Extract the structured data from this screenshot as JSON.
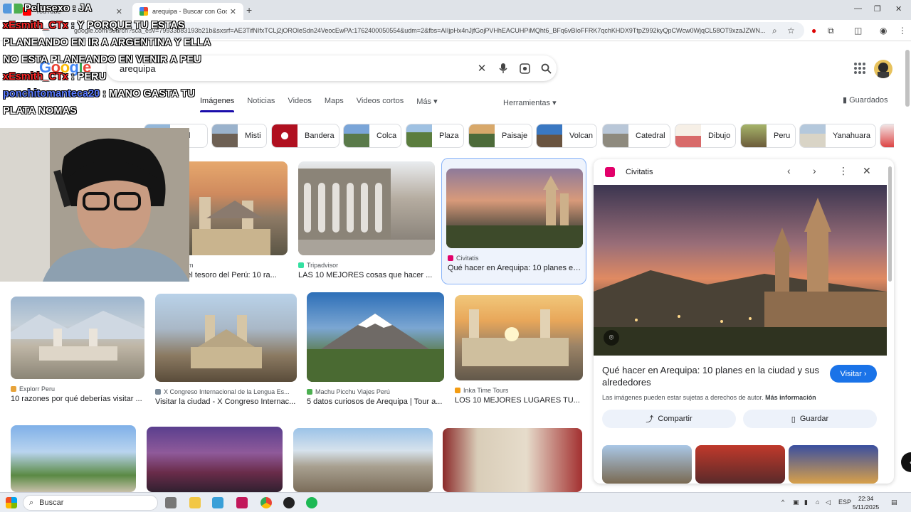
{
  "browser": {
    "tabs": [
      {
        "label": "YouTube",
        "active": false
      },
      {
        "label": "arequipa - Buscar con Google",
        "active": true
      }
    ],
    "url": "google.com/search?sca_esv=79933b83193b21b&sxsrf=AE3TifNIfxTCLj2jOROleSdn24VeocEwPA:1762400050554&udm=2&fbs=AIIjpHx4nJjfGojPVHhEACUHPiMQht6_BFq6vBIoFFRK7qchKHDX9TtpZ992kyQpCWcw0WjqCL58OT9xzaJZWN..."
  },
  "google": {
    "search_query": "arequipa",
    "nav_tabs": [
      "Imágenes",
      "Noticias",
      "Videos",
      "Maps",
      "Videos cortos",
      "Más"
    ],
    "tools_label": "Herramientas",
    "saved_label": "Guardados",
    "chips": [
      "Misti",
      "Bandera",
      "Colca",
      "Plaza",
      "Paisaje",
      "Volcan",
      "Catedral",
      "Dibujo",
      "Peru",
      "Yanahuara"
    ],
    "chip_partial": "dad",
    "results_row1": [
      {
        "source": "l.com",
        "title": "a, el tesoro del Perú: 10 ra..."
      },
      {
        "source": "Tripadvisor",
        "title": "LAS 10 MEJORES cosas que hacer ..."
      },
      {
        "source": "Civitatis",
        "title": "Qué hacer en Arequipa: 10 planes en..."
      }
    ],
    "results_row2": [
      {
        "source": "Explorr Peru",
        "title": "10 razones por qué deberías visitar ..."
      },
      {
        "source": "X Congreso Internacional de la Lengua Es...",
        "title": "Visitar la ciudad - X Congreso Internac..."
      },
      {
        "source": "Machu Picchu Viajes Perú",
        "title": "5 datos curiosos de Arequipa | Tour a..."
      },
      {
        "source": "Inka Time Tours",
        "title": "LOS 10 MEJORES LUGARES TU..."
      }
    ]
  },
  "panel": {
    "source": "Civitatis",
    "title": "Qué hacer en Arequipa: 10 planes en la ciudad y sus alrededores",
    "visit_label": "Visitar",
    "copyright": "Las imágenes pueden estar sujetas a derechos de autor.",
    "more_info": "Más información",
    "share_label": "Compartir",
    "save_label": "Guardar"
  },
  "stream": {
    "chat": [
      {
        "nick": "Pelusexo",
        "text": ": JA"
      },
      {
        "nick": "xEsmith_CTx",
        "text": ": Y PORQUE TU ESTAS PLANEANDO EN IR A ARGENTINA Y ELLA NO ESTA PLANEANDO EN VENIR A PEU"
      },
      {
        "nick": "xEsmith_CTx",
        "text": ": PERU"
      },
      {
        "nick": "ponchitomanteca20",
        "text": ": MANO GASTA TU PLATA NOMAS"
      }
    ]
  },
  "taskbar": {
    "search_label": "Buscar",
    "language": "ESP",
    "time": "22:34",
    "date": "5/11/2025"
  },
  "colors": {
    "google_blue": "#4285f4",
    "google_red": "#ea4335",
    "google_yellow": "#fbbc05",
    "google_green": "#34a853",
    "visit_button": "#1a73e8",
    "chat_nick_red": "#ff2a2a",
    "chat_nick_blue": "#5a7bff"
  }
}
